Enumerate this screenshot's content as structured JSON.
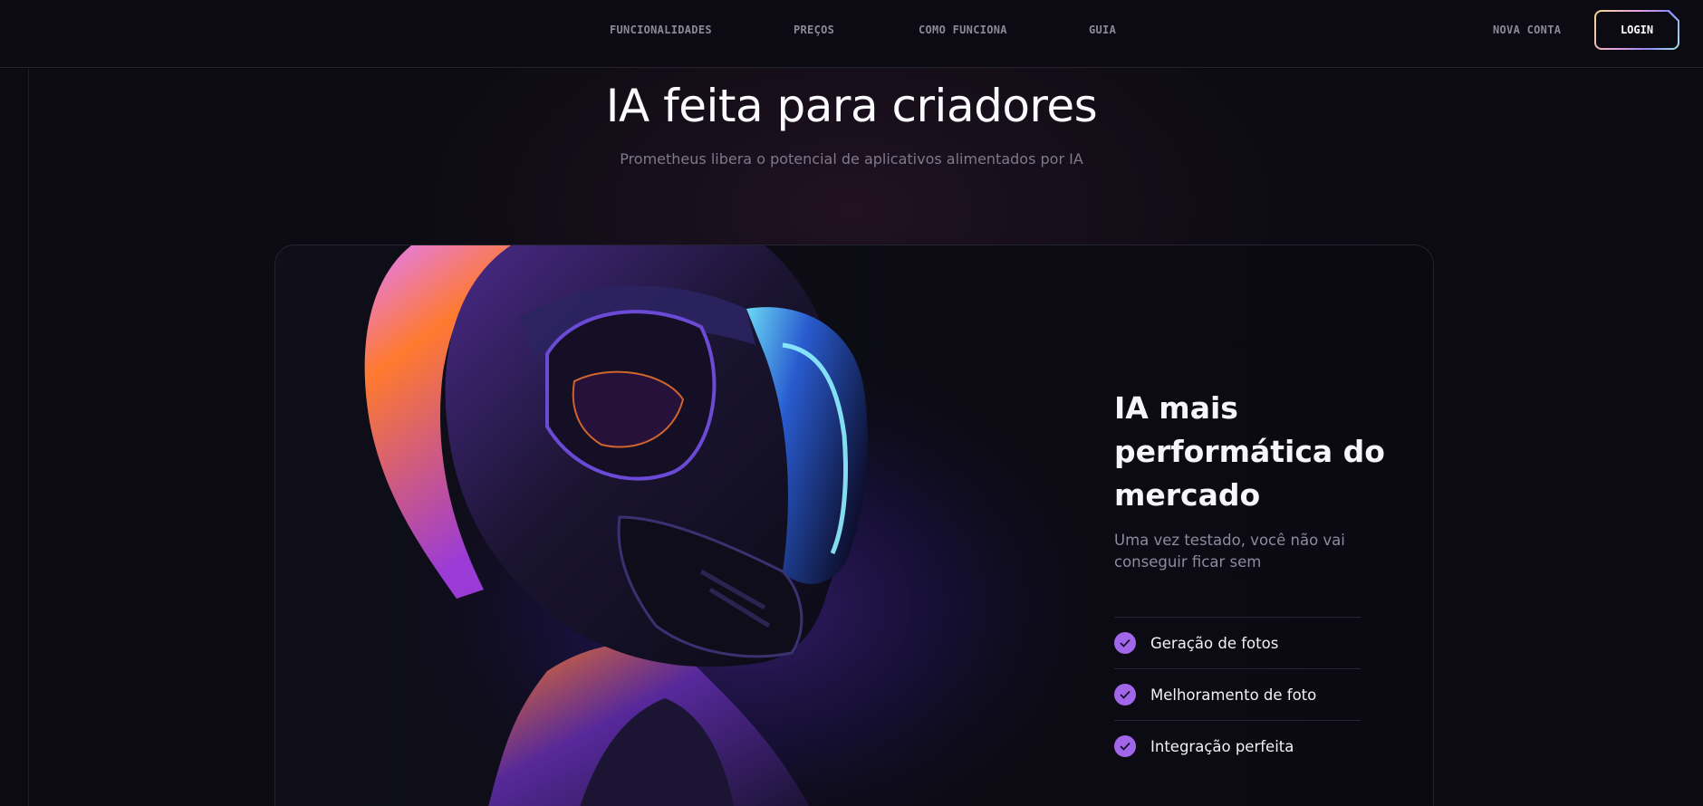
{
  "nav": {
    "items": [
      {
        "label": "FUNCIONALIDADES"
      },
      {
        "label": "PREÇOS"
      },
      {
        "label": "COMO FUNCIONA"
      },
      {
        "label": "GUIA"
      }
    ],
    "new_account": "NOVA CONTA",
    "login": "LOGIN"
  },
  "hero": {
    "title": "IA feita para criadores",
    "subtitle": "Prometheus libera o potencial de aplicativos alimentados por IA"
  },
  "card": {
    "title": "IA mais performática do mercado",
    "subtitle": "Uma vez testado, você não vai conseguir ficar sem",
    "features": [
      {
        "label": "Geração de fotos"
      },
      {
        "label": "Melhoramento de foto"
      },
      {
        "label": "Integração perfeita"
      }
    ]
  },
  "colors": {
    "background": "#0c0b13",
    "accent_check": "#a266ea",
    "muted_text": "#7d7a8c"
  },
  "icons": {
    "check": "check-icon",
    "illustration": "helmeted-figure-illustration"
  }
}
